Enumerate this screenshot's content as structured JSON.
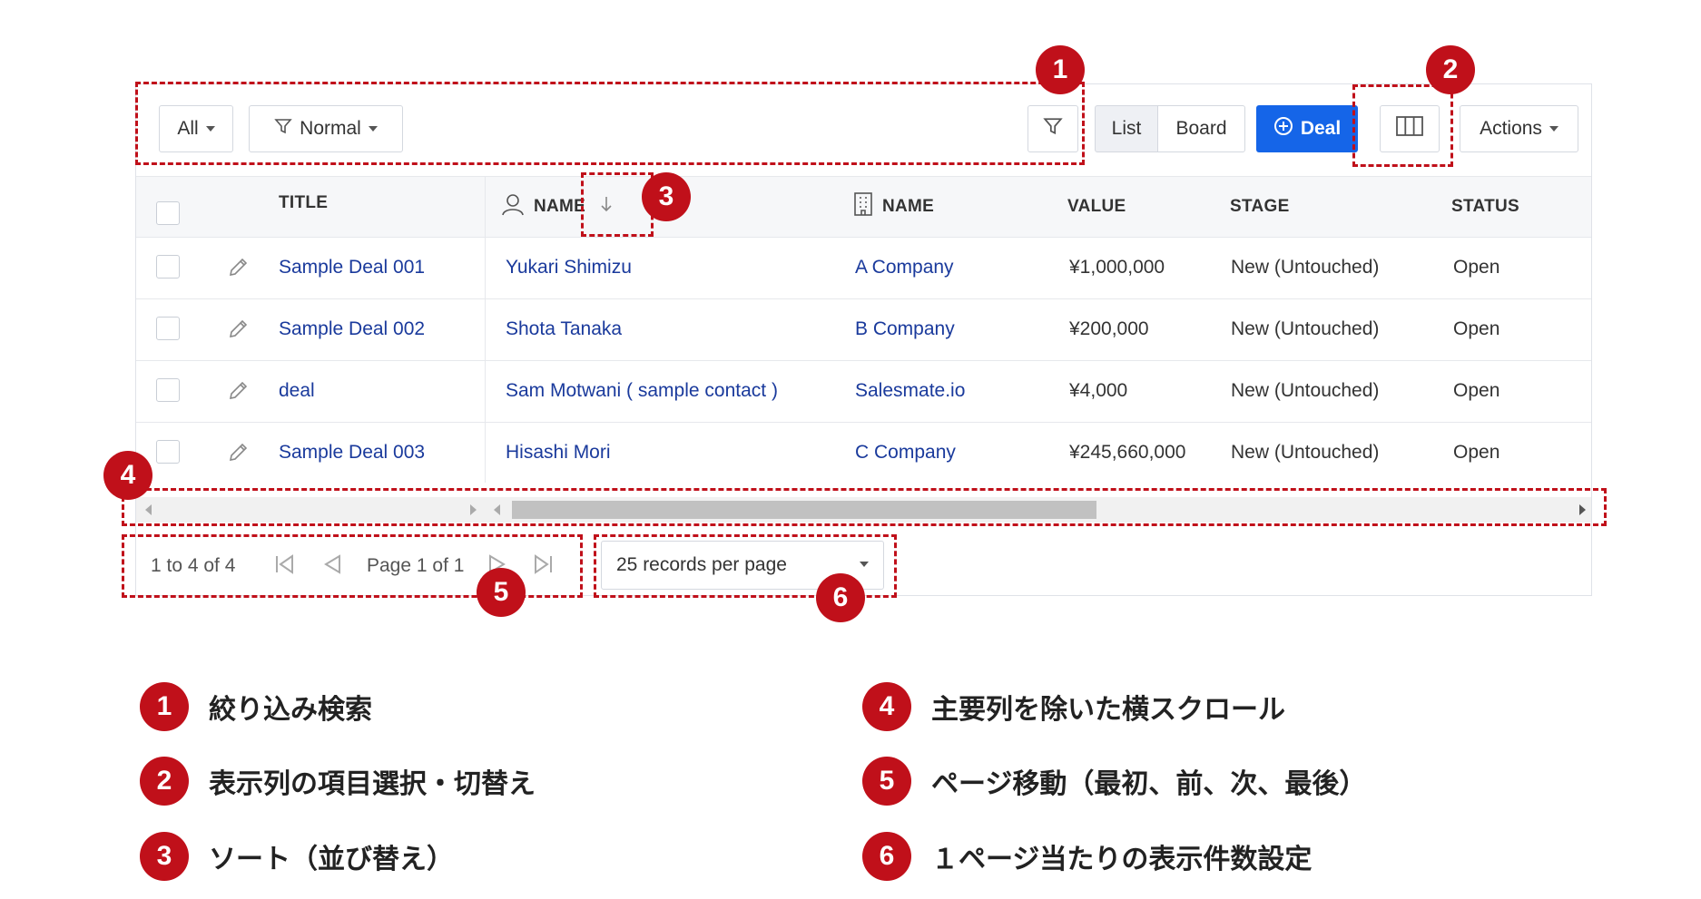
{
  "toolbar": {
    "all_label": "All",
    "normal_label": "Normal",
    "list_label": "List",
    "board_label": "Board",
    "deal_label": "Deal",
    "actions_label": "Actions"
  },
  "table": {
    "headers": {
      "title": "TITLE",
      "contact_name": "NAME",
      "company_name": "NAME",
      "value": "VALUE",
      "stage": "STAGE",
      "status": "STATUS"
    },
    "rows": [
      {
        "title": "Sample Deal 001",
        "contact": "Yukari Shimizu",
        "company": "A Company",
        "value": "¥1,000,000",
        "stage": "New (Untouched)",
        "status": "Open"
      },
      {
        "title": "Sample Deal 002",
        "contact": "Shota Tanaka",
        "company": "B Company",
        "value": "¥200,000",
        "stage": "New (Untouched)",
        "status": "Open"
      },
      {
        "title": "deal",
        "contact": "Sam Motwani ( sample contact )",
        "company": "Salesmate.io",
        "value": "¥4,000",
        "stage": "New (Untouched)",
        "status": "Open"
      },
      {
        "title": "Sample Deal 003",
        "contact": "Hisashi Mori",
        "company": "C Company",
        "value": "¥245,660,000",
        "stage": "New (Untouched)",
        "status": "Open"
      }
    ]
  },
  "pagination": {
    "range": "1 to 4 of 4",
    "page": "Page 1 of 1",
    "per_page": "25 records per page"
  },
  "callouts": [
    "1",
    "2",
    "3",
    "4",
    "5",
    "6"
  ],
  "legend": [
    {
      "num": "1",
      "text": "絞り込み検索"
    },
    {
      "num": "2",
      "text": "表示列の項目選択・切替え"
    },
    {
      "num": "3",
      "text": "ソート（並び替え）"
    },
    {
      "num": "4",
      "text": "主要列を除いた横スクロール"
    },
    {
      "num": "5",
      "text": "ページ移動（最初、前、次、最後）"
    },
    {
      "num": "6",
      "text": "１ページ当たりの表示件数設定"
    }
  ],
  "colors": {
    "accent": "#1565e8",
    "callout": "#c0101a",
    "link": "#1a3a9c"
  }
}
